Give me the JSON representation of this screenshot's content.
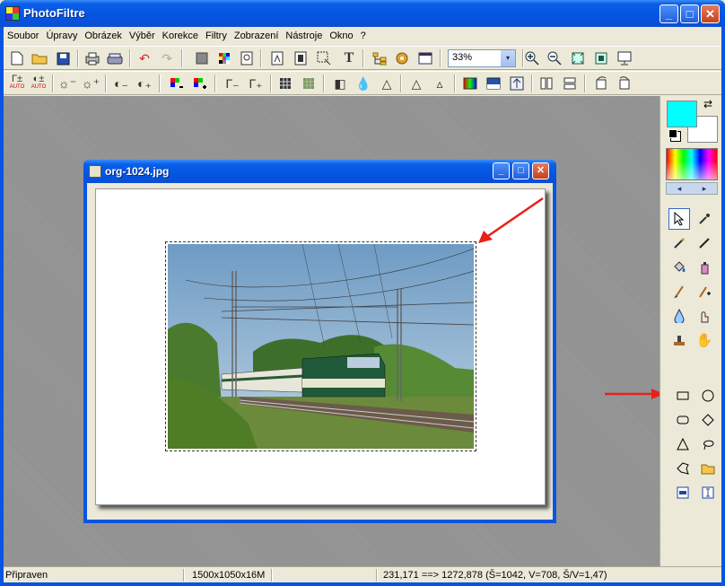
{
  "app": {
    "title": "PhotoFiltre"
  },
  "window_buttons": {
    "minimize": "_",
    "maximize": "□",
    "close": "✕"
  },
  "menu": [
    "Soubor",
    "Úpravy",
    "Obrázek",
    "Výběr",
    "Korekce",
    "Filtry",
    "Zobrazení",
    "Nástroje",
    "Okno",
    "?"
  ],
  "toolbar": {
    "zoom_value": "33%",
    "zoom_arrow": "▾",
    "text_tool": "T"
  },
  "toolbar2": {
    "auto_label": "AUTO"
  },
  "document": {
    "title": "org-1024.jpg"
  },
  "status": {
    "state": "Připraven",
    "image_info": "1500x1050x16M",
    "selection": "231,171 ==> 1272,878 (Š=1042, V=708, Š/V=1,47)"
  },
  "colors": {
    "foreground": "#00ffff",
    "background": "#ffffff",
    "annotation": "#e8201c"
  },
  "palette_nav": {
    "prev": "◂",
    "next": "▸"
  }
}
